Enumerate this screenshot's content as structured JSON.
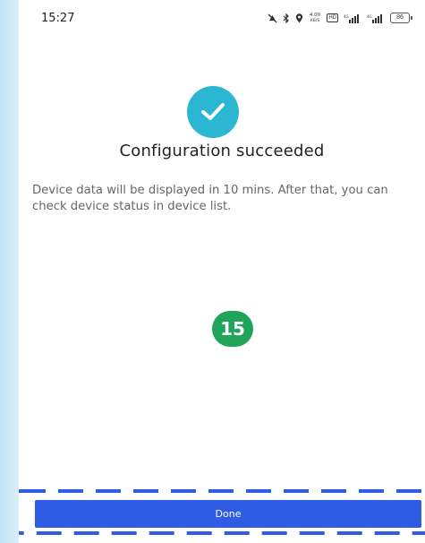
{
  "status_bar": {
    "time": "15:27",
    "speed": "4.00\nKB/S",
    "hd_label": "HD",
    "battery_level": "86",
    "icons": [
      "mute-icon",
      "bluetooth-icon",
      "location-icon",
      "network-speed",
      "hd-icon",
      "signal-icon",
      "signal-icon",
      "battery-icon"
    ]
  },
  "main": {
    "title": "Configuration succeeded",
    "description": "Device data will be displayed in 10 mins. After that, you can check device status in device list.",
    "countdown": "15",
    "success_icon": "checkmark-icon",
    "success_color": "#2bb7d1",
    "countdown_color": "#1fa45a"
  },
  "footer": {
    "done_label": "Done",
    "button_color": "#2f5ce4",
    "highlight_color": "#2f5ce4"
  }
}
